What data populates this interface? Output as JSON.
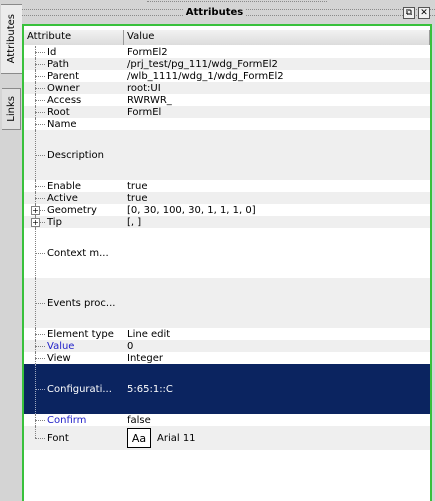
{
  "side_tabs": [
    "Attributes",
    "Links"
  ],
  "dock": {
    "title": "Attributes",
    "float_icon": "float-icon",
    "close_icon": "close-icon"
  },
  "table": {
    "headers": [
      "Attribute",
      "Value"
    ],
    "rows": [
      {
        "name": "Id",
        "value": "FormEl2"
      },
      {
        "name": "Path",
        "value": "/prj_test/pg_111/wdg_FormEl2"
      },
      {
        "name": "Parent",
        "value": "/wlb_1111/wdg_1/wdg_FormEl2"
      },
      {
        "name": "Owner",
        "value": "root:UI"
      },
      {
        "name": "Access",
        "value": "RWRWR_"
      },
      {
        "name": "Root",
        "value": "FormEl"
      },
      {
        "name": "Name",
        "value": ""
      },
      {
        "name": "Description",
        "value": ""
      },
      {
        "name": "Enable",
        "value": "true"
      },
      {
        "name": "Active",
        "value": "true"
      },
      {
        "name": "Geometry",
        "value": "[0, 30, 100, 30, 1, 1, 1, 0]"
      },
      {
        "name": "Tip",
        "value": "[, ]"
      },
      {
        "name": "Context m...",
        "value": ""
      },
      {
        "name": "Events proc...",
        "value": ""
      },
      {
        "name": "Element type",
        "value": "Line edit"
      },
      {
        "name": "Value",
        "value": "0"
      },
      {
        "name": "View",
        "value": "Integer"
      },
      {
        "name": "Configurati...",
        "value": "5:65:1::C"
      },
      {
        "name": "Confirm",
        "value": "false"
      },
      {
        "name": "Font",
        "value": "Arial 11",
        "swatch": "Aa"
      }
    ]
  },
  "colors": {
    "focus_frame": "#39c13c",
    "selection": "#0b2460",
    "highlight_text": "#1e1ec8"
  }
}
